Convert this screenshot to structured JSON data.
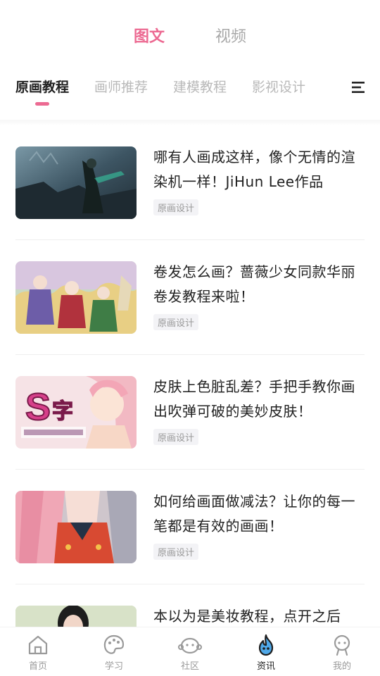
{
  "top_tabs": [
    {
      "label": "图文",
      "active": true
    },
    {
      "label": "视频",
      "active": false
    }
  ],
  "category_tabs": [
    {
      "label": "原画教程",
      "active": true
    },
    {
      "label": "画师推荐",
      "active": false
    },
    {
      "label": "建模教程",
      "active": false
    },
    {
      "label": "影视设计",
      "active": false
    }
  ],
  "menu_icon": "list-menu-icon",
  "articles": [
    {
      "title": "哪有人画成这样，像个无情的渲染机一样！JiHun Lee作品",
      "tag": "原画设计"
    },
    {
      "title": "卷发怎么画？蔷薇少女同款华丽卷发教程来啦！",
      "tag": "原画设计"
    },
    {
      "title": "皮肤上色脏乱差？手把手教你画出吹弹可破的美妙皮肤！",
      "tag": "原画设计"
    },
    {
      "title": "如何给画面做减法？让你的每一笔都是有效的画画！",
      "tag": "原画设计"
    },
    {
      "title": "本以为是美妆教程，点开之后",
      "tag": ""
    }
  ],
  "bottom_nav": [
    {
      "label": "首页",
      "icon": "home-icon",
      "active": false
    },
    {
      "label": "学习",
      "icon": "palette-icon",
      "active": false
    },
    {
      "label": "社区",
      "icon": "community-icon",
      "active": false
    },
    {
      "label": "资讯",
      "icon": "news-flame-icon",
      "active": true
    },
    {
      "label": "我的",
      "icon": "profile-icon",
      "active": false
    }
  ],
  "colors": {
    "accent": "#ec6a92",
    "inactive_text": "#b9b9b9",
    "nav_active": "#222222"
  }
}
